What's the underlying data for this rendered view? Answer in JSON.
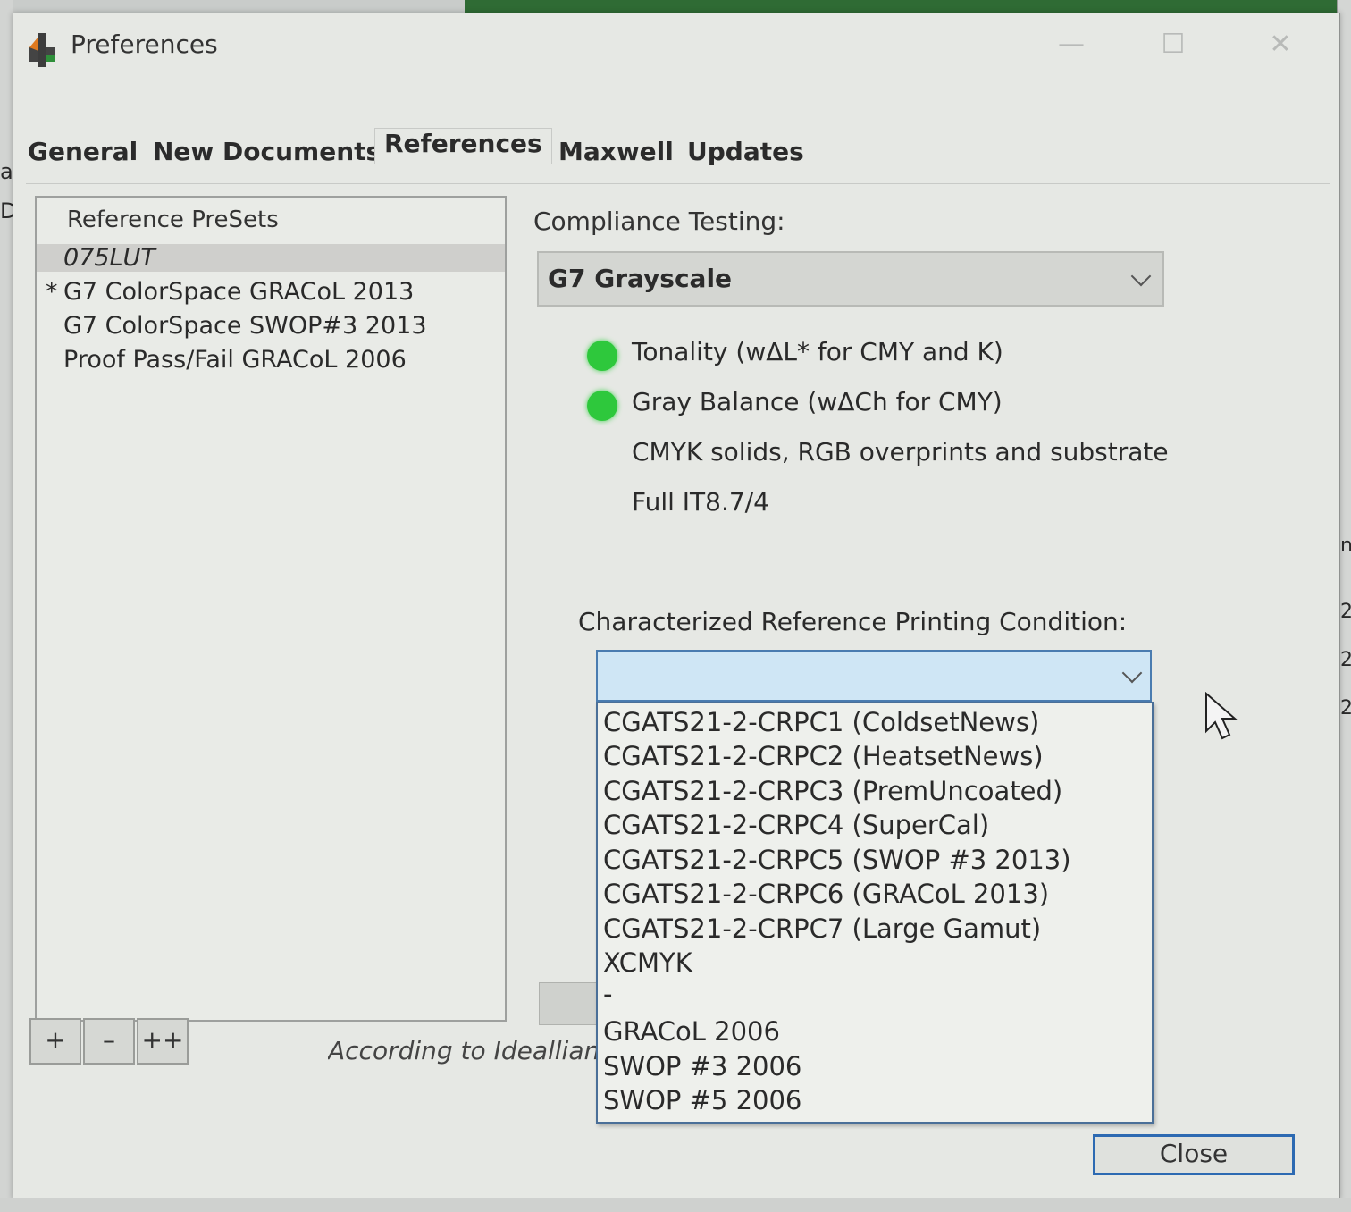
{
  "window": {
    "title": "Preferences",
    "controls": {
      "minimize": "—",
      "maximize": "☐",
      "close": "✕"
    }
  },
  "tabs": [
    {
      "label": "General"
    },
    {
      "label": "New Documents"
    },
    {
      "label": "References",
      "active": true
    },
    {
      "label": "Maxwell"
    },
    {
      "label": "Updates"
    }
  ],
  "presets": {
    "header": "Reference PreSets",
    "items": [
      {
        "label": "075LUT",
        "selected": true,
        "mark": ""
      },
      {
        "label": "G7 ColorSpace GRACoL 2013",
        "selected": false,
        "mark": "*"
      },
      {
        "label": "G7 ColorSpace SWOP#3 2013",
        "selected": false,
        "mark": ""
      },
      {
        "label": "Proof Pass/Fail GRACoL 2006",
        "selected": false,
        "mark": ""
      }
    ],
    "buttons": {
      "add": "+",
      "remove": "–",
      "duplicate": "++"
    }
  },
  "compliance": {
    "label": "Compliance Testing:",
    "selected": "G7 Grayscale",
    "checks": [
      {
        "label": "Tonality (wΔL* for CMY and K)",
        "status": "green"
      },
      {
        "label": "Gray Balance (wΔCh for CMY)",
        "status": "green"
      },
      {
        "label": "CMYK solids, RGB overprints and substrate",
        "status": ""
      },
      {
        "label": "Full IT8.7/4",
        "status": ""
      }
    ]
  },
  "crpc": {
    "label": "Characterized Reference Printing Condition:",
    "selected": "",
    "options": [
      "CGATS21-2-CRPC1 (ColdsetNews)",
      "CGATS21-2-CRPC2 (HeatsetNews)",
      "CGATS21-2-CRPC3 (PremUncoated)",
      "CGATS21-2-CRPC4 (SuperCal)",
      "CGATS21-2-CRPC5 (SWOP #3 2013)",
      "CGATS21-2-CRPC6 (GRACoL 2013)",
      "CGATS21-2-CRPC7 (Large Gamut)",
      "XCMYK",
      "-",
      "GRACoL 2006",
      "SWOP #3 2006",
      "SWOP #5 2006"
    ]
  },
  "footnote": "According to Idealliance",
  "close_label": "Close",
  "background": {
    "left_fragments": [
      "al",
      "D"
    ],
    "right_fragments": [
      "n",
      "2",
      "2",
      "2"
    ]
  },
  "colors": {
    "status_green": "#2ec83c",
    "focus_blue": "#2d6ab2"
  }
}
